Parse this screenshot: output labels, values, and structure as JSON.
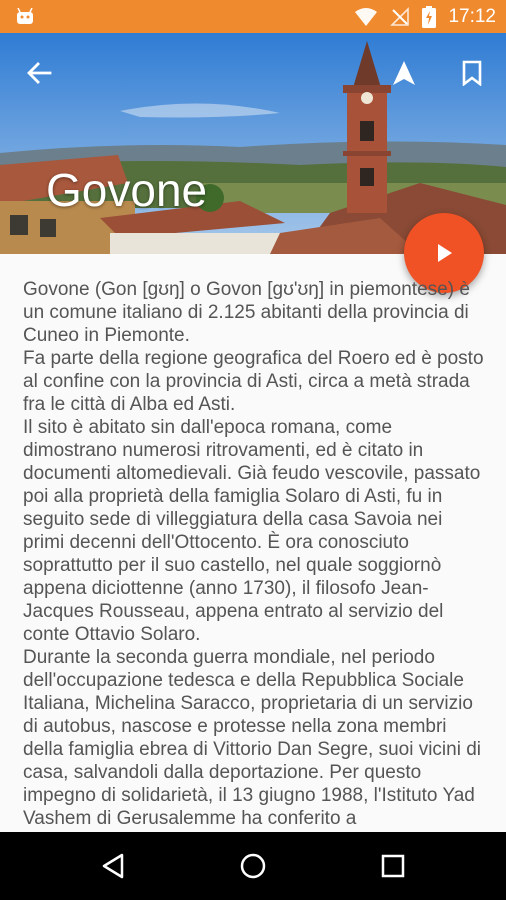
{
  "status_bar": {
    "time": "17:12",
    "icons": [
      "android-icon",
      "wifi-icon",
      "no-signal-icon",
      "battery-charging-icon"
    ]
  },
  "header": {
    "title": "Govone",
    "back_icon": "arrow-back-icon",
    "navigate_icon": "navigation-arrow-icon",
    "bookmark_icon": "bookmark-icon"
  },
  "fab": {
    "icon": "play-icon",
    "color": "#f05125"
  },
  "article": {
    "paragraphs": [
      "Govone (Gon [gʊŋ] o Govon [gʊ'ʊŋ] in piemontese) è un comune italiano di 2.125 abitanti della provincia di Cuneo in Piemonte.",
      "Fa parte della regione geografica del Roero ed è posto al confine con la provincia di Asti, circa a metà strada fra le città di Alba ed Asti.",
      "Il sito è abitato sin dall'epoca romana, come dimostrano numerosi ritrovamenti, ed è citato in documenti altomedievali. Già feudo vescovile, passato poi alla proprietà della famiglia Solaro di Asti, fu in seguito sede di villeggiatura della casa Savoia nei primi decenni dell'Ottocento. È ora conosciuto soprattutto per il suo castello, nel quale soggiornò appena diciottenne (anno 1730), il filosofo Jean-Jacques Rousseau, appena entrato al servizio del conte Ottavio Solaro.",
      "Durante la seconda guerra mondiale, nel periodo dell'occupazione tedesca e della Repubblica Sociale Italiana, Michelina Saracco, proprietaria di un servizio di autobus, nascose e protesse nella zona membri della famiglia ebrea di Vittorio Dan Segre, suoi vicini di casa, salvandoli dalla deportazione. Per questo impegno di solidarietà, il 13 giugno 1988, l'Istituto Yad Vashem di Gerusalemme ha conferito a"
    ]
  },
  "nav_bar": {
    "icons": [
      "back-triangle-icon",
      "home-circle-icon",
      "recents-square-icon"
    ]
  },
  "colors": {
    "status_bar": "#f08a2e",
    "accent": "#f05125",
    "text": "#555555"
  }
}
